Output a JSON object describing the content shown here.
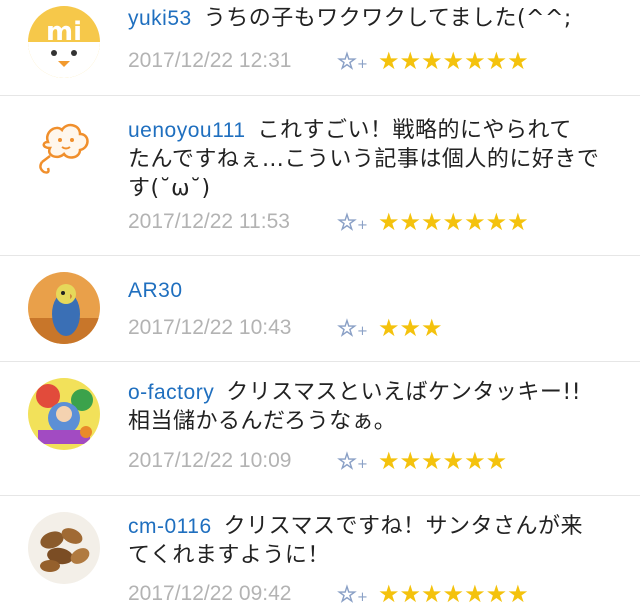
{
  "comments": [
    {
      "user": "yuki53",
      "lines": [
        "うちの子もワクワクしてました(^^;"
      ],
      "time": "2017/12/22 12:31",
      "star_add_icon": "add-star-icon",
      "star_rating": 7,
      "stars": "★★★★★★★",
      "avatar_icon": "mi-chick-avatar"
    },
    {
      "user": "uenoyou111",
      "lines": [
        "これすごい！戦略的にやられて",
        "たんですねぇ…こういう記事は個人的に好きで",
        "す(˘ω˘)"
      ],
      "time": "2017/12/22 11:53",
      "star_add_icon": "add-star-icon",
      "star_rating": 7,
      "stars": "★★★★★★★",
      "avatar_icon": "cloud-face-avatar"
    },
    {
      "user": "AR30",
      "lines": [],
      "time": "2017/12/22 10:43",
      "star_add_icon": "add-star-icon",
      "star_rating": 3,
      "stars": "★★★",
      "avatar_icon": "parakeet-avatar"
    },
    {
      "user": "o-factory",
      "lines": [
        "クリスマスといえばケンタッキー!!",
        "相当儲かるんだろうなぁ。"
      ],
      "time": "2017/12/22 10:09",
      "star_add_icon": "add-star-icon",
      "star_rating": 6,
      "stars": "★★★★★★",
      "avatar_icon": "illustration-avatar"
    },
    {
      "user": "cm-0116",
      "lines": [
        "クリスマスですね！サンタさんが来",
        "てくれますように！"
      ],
      "time": "2017/12/22 09:42",
      "star_add_icon": "add-star-icon",
      "star_rating": 7,
      "stars": "★★★★★★★",
      "avatar_icon": "nuts-avatar"
    }
  ],
  "star_add_label": "+",
  "colors": {
    "username": "#1f6fbf",
    "timestamp": "#b3b3b3",
    "star": "#f4c20d",
    "add_star": "#8aa0c6",
    "divider": "#e6e6e6"
  }
}
